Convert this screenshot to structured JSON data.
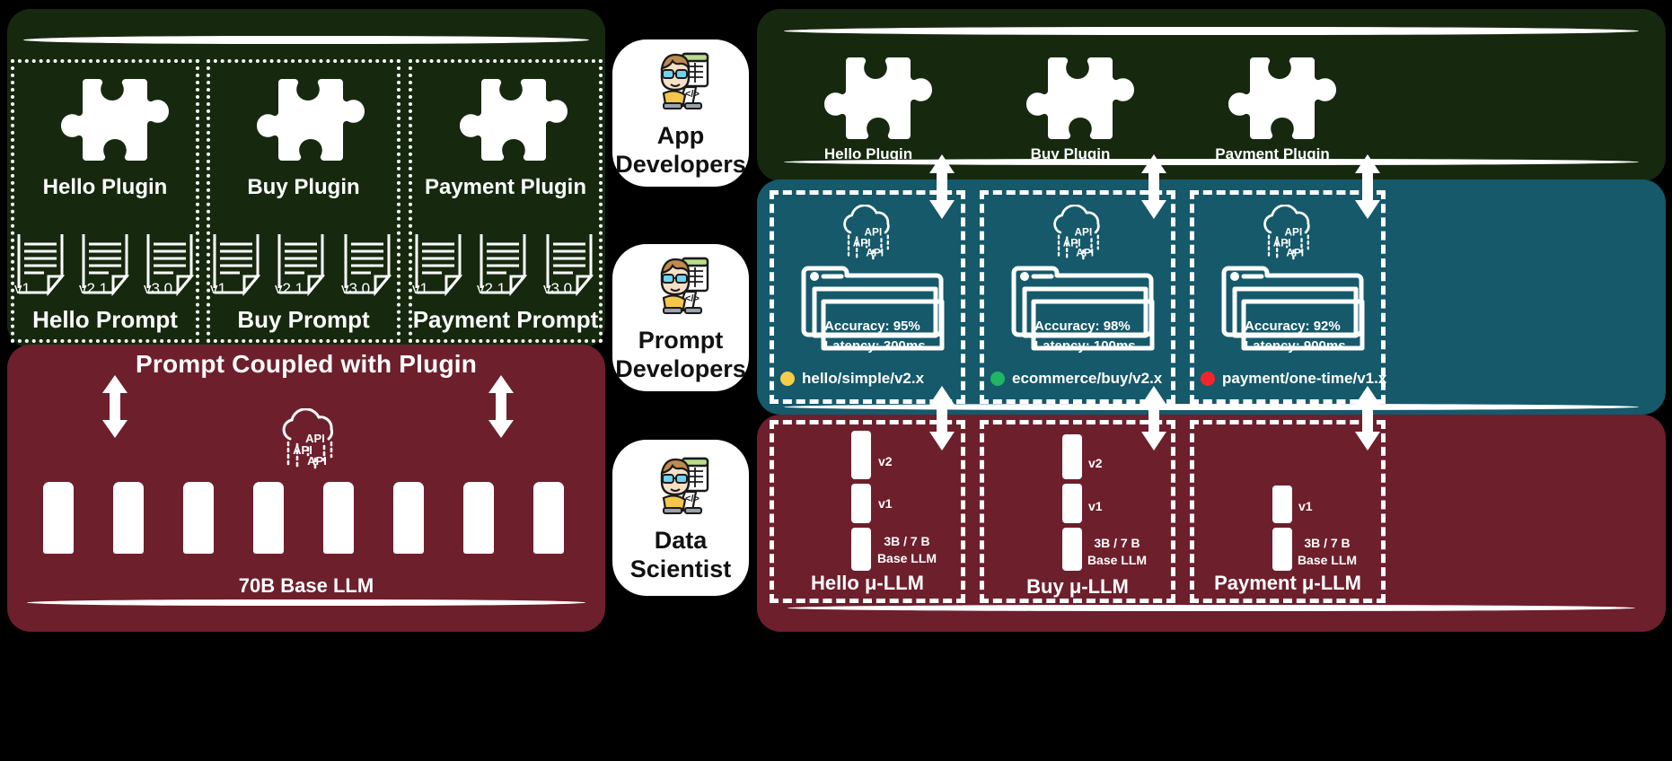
{
  "left_panel": {
    "columns": [
      {
        "plugin_label": "Hello Plugin",
        "prompt_label": "Hello Prompt",
        "versions": [
          "v1",
          "v2.1",
          "v3.0"
        ]
      },
      {
        "plugin_label": "Buy Plugin",
        "prompt_label": "Buy Prompt",
        "versions": [
          "v1",
          "v2.1",
          "v3.0"
        ]
      },
      {
        "plugin_label": "Payment Plugin",
        "prompt_label": "Payment Prompt",
        "versions": [
          "v1",
          "v2.1",
          "v3.0"
        ]
      }
    ],
    "coupling_banner": "Prompt Coupled with Plugin",
    "base_llm_label": "70B Base LLM",
    "api_icon_text": [
      "API",
      "API",
      "API"
    ],
    "bar_count": 8
  },
  "personas": [
    {
      "title": "App\nDevelopers",
      "icon": "developer-avatar-icon"
    },
    {
      "title": "Prompt\nDevelopers",
      "icon": "developer-avatar-icon"
    },
    {
      "title": "Data\nScientist",
      "icon": "developer-avatar-icon"
    }
  ],
  "right_panel": {
    "plugins": [
      {
        "label": "Hello Plugin"
      },
      {
        "label": "Buy Plugin"
      },
      {
        "label": "Payment Plugin"
      }
    ],
    "prompt_registries": [
      {
        "accuracy": "Accuracy: 95%",
        "latency": "Latency: 300ms",
        "model_path": "hello/simple/v2.x",
        "dot_color": "#f2ce4b"
      },
      {
        "accuracy": "Accuracy: 98%",
        "latency": "Latency: 100ms",
        "model_path": "ecommerce/buy/v2.x",
        "dot_color": "#1fb562"
      },
      {
        "accuracy": "Accuracy: 92%",
        "latency": "Latency: 900ms",
        "model_path": "payment/one-time/v1.x",
        "dot_color": "#f0262c"
      }
    ],
    "micro_llms": [
      {
        "label": "Hello μ-LLM",
        "versions": [
          "v2",
          "v1"
        ],
        "base_size": "3B / 7 B",
        "base_caption": "Base LLM"
      },
      {
        "label": "Buy μ-LLM",
        "versions": [
          "v2",
          "v1"
        ],
        "base_size": "3B / 7 B",
        "base_caption": "Base LLM"
      },
      {
        "label": "Payment μ-LLM",
        "versions": [
          "v1"
        ],
        "base_size": "3B / 7 B",
        "base_caption": "Base LLM"
      }
    ]
  },
  "colors": {
    "green_panel": "#16290f",
    "maroon_panel": "#6e1f2c",
    "teal_panel": "#15596b",
    "background": "#000000",
    "stroke": "#ffffff"
  }
}
